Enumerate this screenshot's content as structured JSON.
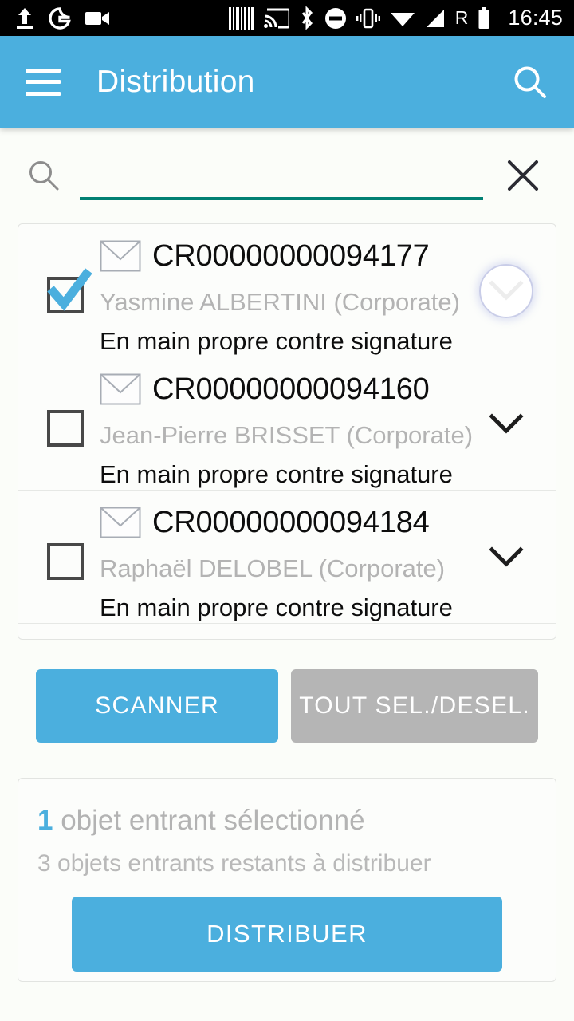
{
  "status_bar": {
    "time": "16:45",
    "roaming_label": "R",
    "left_icons": [
      "upload-icon",
      "google-icon",
      "video-camera-icon"
    ],
    "right_icons": [
      "barcode-icon",
      "cast-icon",
      "bluetooth-icon",
      "do-not-disturb-icon",
      "vibrate-icon",
      "wifi-icon",
      "cellular-signal-icon",
      "roaming-icon",
      "battery-icon"
    ]
  },
  "app_bar": {
    "title": "Distribution",
    "menu_icon": "hamburger-menu-icon",
    "search_icon": "search-icon",
    "background_color": "#4bafde"
  },
  "search": {
    "value": "",
    "placeholder": "",
    "leading_icon": "search-icon",
    "clear_icon": "close-icon",
    "underline_color": "#018073"
  },
  "list": {
    "items": [
      {
        "reference": "CR00000000094177",
        "recipient": "Yasmine ALBERTINI (Corporate)",
        "delivery_mode": "En main propre contre signature",
        "checked": true,
        "expand_icon": "chevron-down-icon",
        "ripple": true
      },
      {
        "reference": "CR00000000094160",
        "recipient": "Jean-Pierre BRISSET (Corporate)",
        "delivery_mode": "En main propre contre signature",
        "checked": false,
        "expand_icon": "chevron-down-icon",
        "ripple": false
      },
      {
        "reference": "CR00000000094184",
        "recipient": "Raphaël DELOBEL (Corporate)",
        "delivery_mode": "En main propre contre signature",
        "checked": false,
        "expand_icon": "chevron-down-icon",
        "ripple": false
      }
    ]
  },
  "actions": {
    "scan_label": "SCANNER",
    "select_all_label": "TOUT SEL./DESEL.",
    "scan_color": "#4bafde",
    "select_all_color": "#b5b5b5"
  },
  "summary": {
    "selected_count": "1",
    "selected_text": " objet entrant sélectionné",
    "remaining_text": "3 objets entrants restants à distribuer",
    "distribute_label": "DISTRIBUER",
    "accent_color": "#4bafde"
  }
}
